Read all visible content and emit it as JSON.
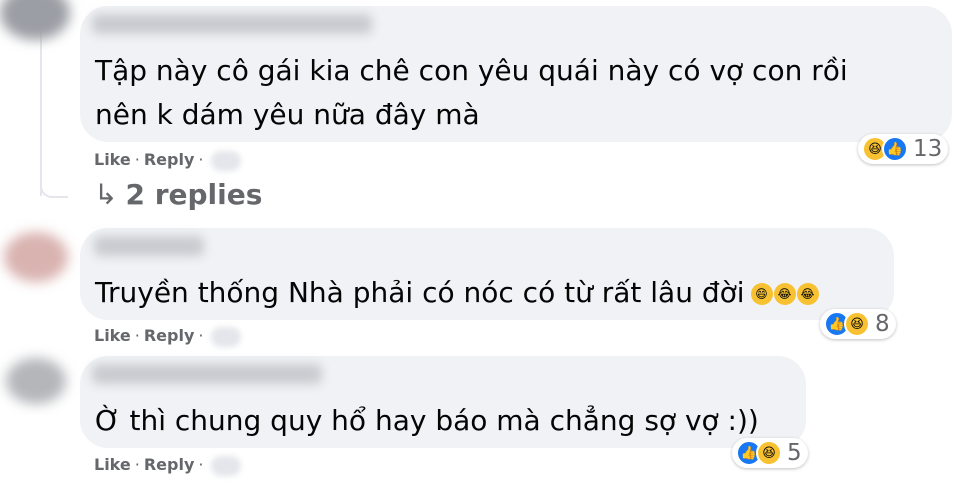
{
  "comments": [
    {
      "lines": [
        "Tập này cô gái kia chê con yêu quái này có vợ con rồi",
        "nên k dám yêu nữa đây mà"
      ],
      "actions": {
        "like": "Like",
        "reply": "Reply"
      },
      "reactions": {
        "count": "13",
        "icons": [
          "haha-icon",
          "like-icon"
        ]
      },
      "replies": {
        "arrow": "↳",
        "label": "2 replies"
      }
    },
    {
      "lines": [
        "Truyền thống Nhà phải có nóc có từ rất lâu đời"
      ],
      "inline_emoji": [
        "grinning-emoji",
        "laughing-emoji",
        "laughing-emoji"
      ],
      "actions": {
        "like": "Like",
        "reply": "Reply"
      },
      "reactions": {
        "count": "8",
        "icons": [
          "like-icon",
          "haha-icon"
        ]
      }
    },
    {
      "lines": [
        "Ờ thì chung quy hổ hay báo mà chẳng sợ vợ :))"
      ],
      "actions": {
        "like": "Like",
        "reply": "Reply"
      },
      "reactions": {
        "count": "5",
        "icons": [
          "like-icon",
          "haha-icon"
        ]
      }
    }
  ],
  "separator": "·",
  "colors": {
    "bubble": "#f0f2f5",
    "meta": "#65676b",
    "like_blue": "#1877f2",
    "haha_yellow": "#f7c131"
  }
}
